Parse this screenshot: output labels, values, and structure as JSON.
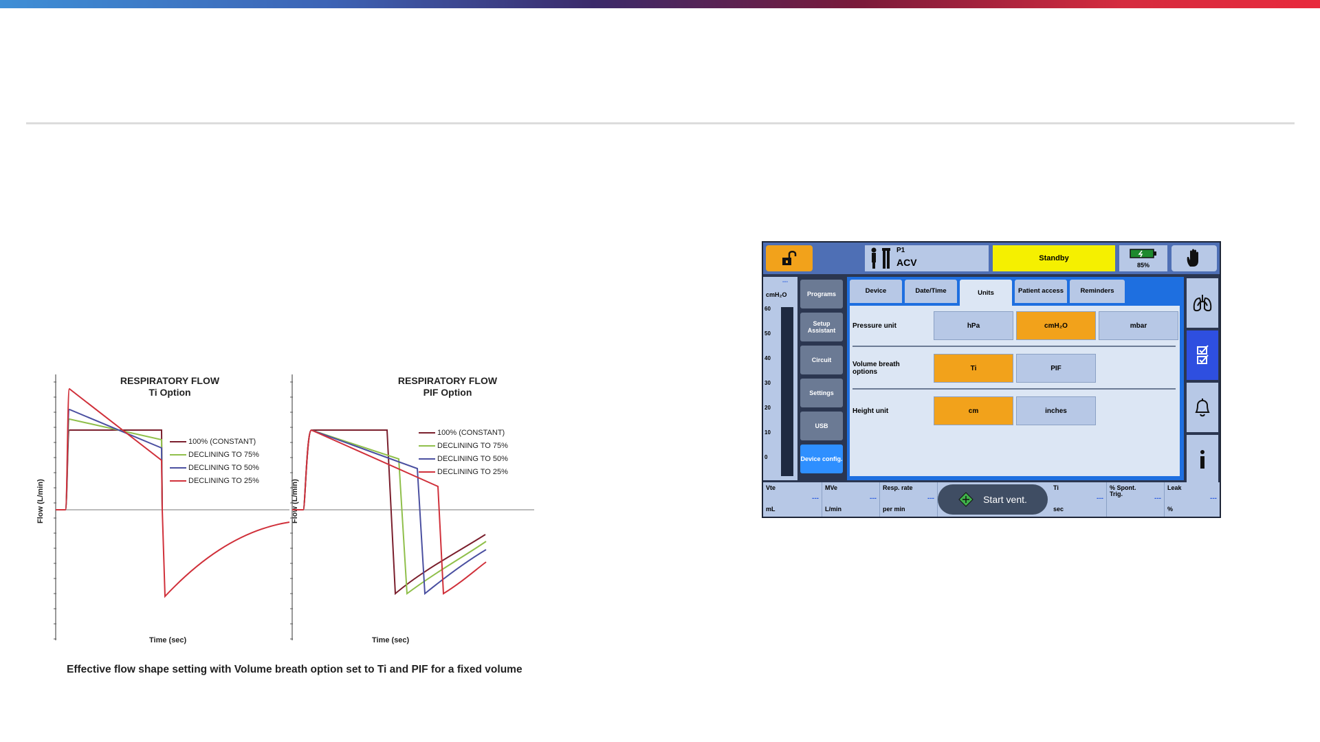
{
  "figure": {
    "left_plot": {
      "title_line1": "RESPIRATORY FLOW",
      "title_line2": "Ti Option",
      "ylabel": "Flow (L/min)",
      "xlabel": "Time (sec)"
    },
    "right_plot": {
      "title_line1": "RESPIRATORY FLOW",
      "title_line2": "PIF Option",
      "ylabel": "Flow (L/min)",
      "xlabel": "Time (sec)"
    },
    "legend": [
      {
        "label": "100% (CONSTANT)",
        "color": "#7a1e2c"
      },
      {
        "label": "DECLINING TO 75%",
        "color": "#8fbf4a"
      },
      {
        "label": "DECLINING TO 50%",
        "color": "#4a4fa0"
      },
      {
        "label": "DECLINING TO 25%",
        "color": "#d0303a"
      }
    ],
    "caption": "Effective flow shape setting with Volume breath option set to Ti and PIF for a fixed volume"
  },
  "device": {
    "patient_id": "P1",
    "mode": "ACV",
    "status": "Standby",
    "battery": "85%",
    "gauge": {
      "top_value": "---",
      "unit": "cmH₂O",
      "ticks": [
        "60",
        "50",
        "40",
        "30",
        "20",
        "10",
        "0"
      ]
    },
    "left_nav": [
      "Programs",
      "Setup Assistant",
      "Circuit",
      "Settings",
      "USB",
      "Device config."
    ],
    "active_nav": "Device config.",
    "tabs": [
      "Device",
      "Date/Time",
      "Units",
      "Patient access",
      "Reminders"
    ],
    "active_tab": "Units",
    "settings": {
      "pressure": {
        "label": "Pressure unit",
        "options": [
          "hPa",
          "cmH₂O",
          "mbar"
        ],
        "selected": "cmH₂O"
      },
      "volume": {
        "label": "Volume breath options",
        "options": [
          "Ti",
          "PIF"
        ],
        "selected": "Ti"
      },
      "height": {
        "label": "Height unit",
        "options": [
          "cm",
          "inches"
        ],
        "selected": "cm"
      }
    },
    "monitors": [
      {
        "label": "Vte",
        "unit": "mL",
        "value": "---"
      },
      {
        "label": "MVe",
        "unit": "L/min",
        "value": "---"
      },
      {
        "label": "Resp. rate",
        "unit": "per min",
        "value": "---"
      },
      {
        "label": "Ti",
        "unit": "sec",
        "value": "---"
      },
      {
        "label": "% Spont. Trig.",
        "unit": "",
        "value": "---"
      },
      {
        "label": "Leak",
        "unit": "%",
        "value": "---"
      }
    ],
    "start_button": "Start vent.",
    "colors": {
      "accent": "#f2a21b",
      "standby": "#f5f000",
      "active_blue": "#1e6fe0"
    }
  }
}
